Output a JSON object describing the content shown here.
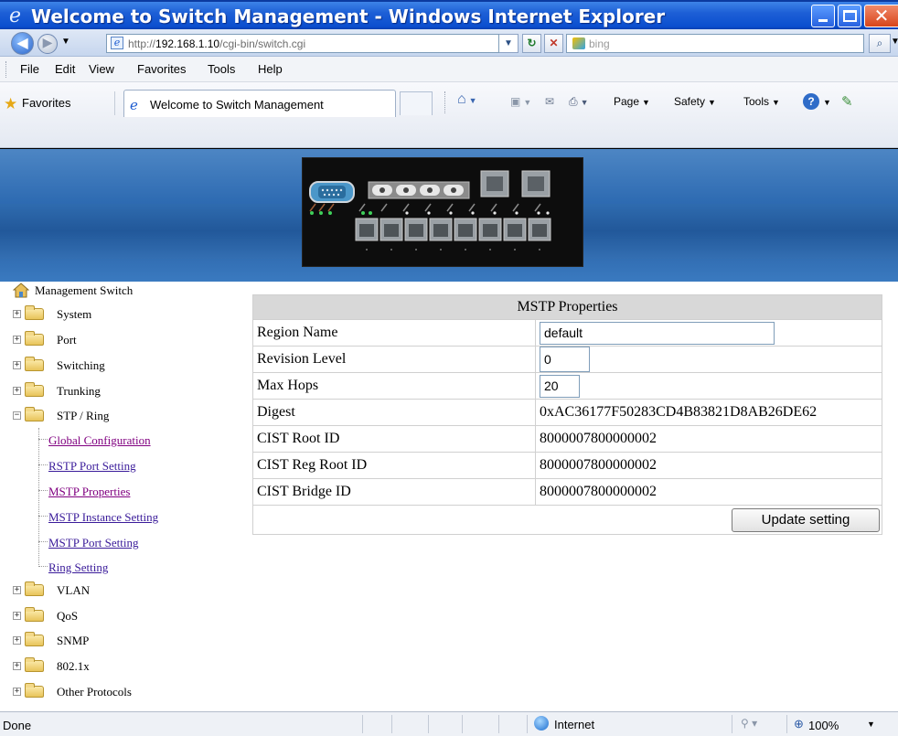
{
  "window": {
    "title": "Welcome to Switch Management - Windows Internet Explorer"
  },
  "address_bar": {
    "url_prefix": "http://",
    "url_host": "192.168.1.10",
    "url_path": "/cgi-bin/switch.cgi",
    "search_placeholder": "bing"
  },
  "menu": [
    "File",
    "Edit",
    "View",
    "Favorites",
    "Tools",
    "Help"
  ],
  "favorites_bar": {
    "favorites_label": "Favorites",
    "tab_title": "Welcome to Switch Management",
    "commands": [
      "Page",
      "Safety",
      "Tools"
    ]
  },
  "sidebar": {
    "root_label": "Management Switch",
    "folders_top": [
      "System",
      "Port",
      "Switching",
      "Trunking",
      "STP / Ring"
    ],
    "stp_links": [
      "Global Configuration",
      "RSTP Port Setting",
      "MSTP Properties",
      "MSTP Instance Setting",
      "MSTP Port Setting",
      "Ring Setting"
    ],
    "folders_bottom": [
      "VLAN",
      "QoS",
      "SNMP",
      "802.1x",
      "Other Protocols"
    ]
  },
  "mstp": {
    "header": "MSTP Properties",
    "region_name_label": "Region Name",
    "region_name_value": "default",
    "revision_level_label": "Revision Level",
    "revision_level_value": "0",
    "max_hops_label": "Max Hops",
    "max_hops_value": "20",
    "digest_label": "Digest",
    "digest_value": "0xAC36177F50283CD4B83821D8AB26DE62",
    "cist_root_label": "CIST Root ID",
    "cist_root_value": "8000007800000002",
    "cist_reg_root_label": "CIST Reg Root ID",
    "cist_reg_root_value": "8000007800000002",
    "cist_bridge_label": "CIST Bridge ID",
    "cist_bridge_value": "8000007800000002",
    "update_button": "Update setting"
  },
  "status_bar": {
    "status": "Done",
    "zone": "Internet",
    "zoom": "100%"
  },
  "colors": {
    "titlebar": "#0b4fcf",
    "banner": "#2e6bb2",
    "link": "#3a1b9a",
    "visited_link": "#800080",
    "table_header": "#d8d8d8"
  }
}
